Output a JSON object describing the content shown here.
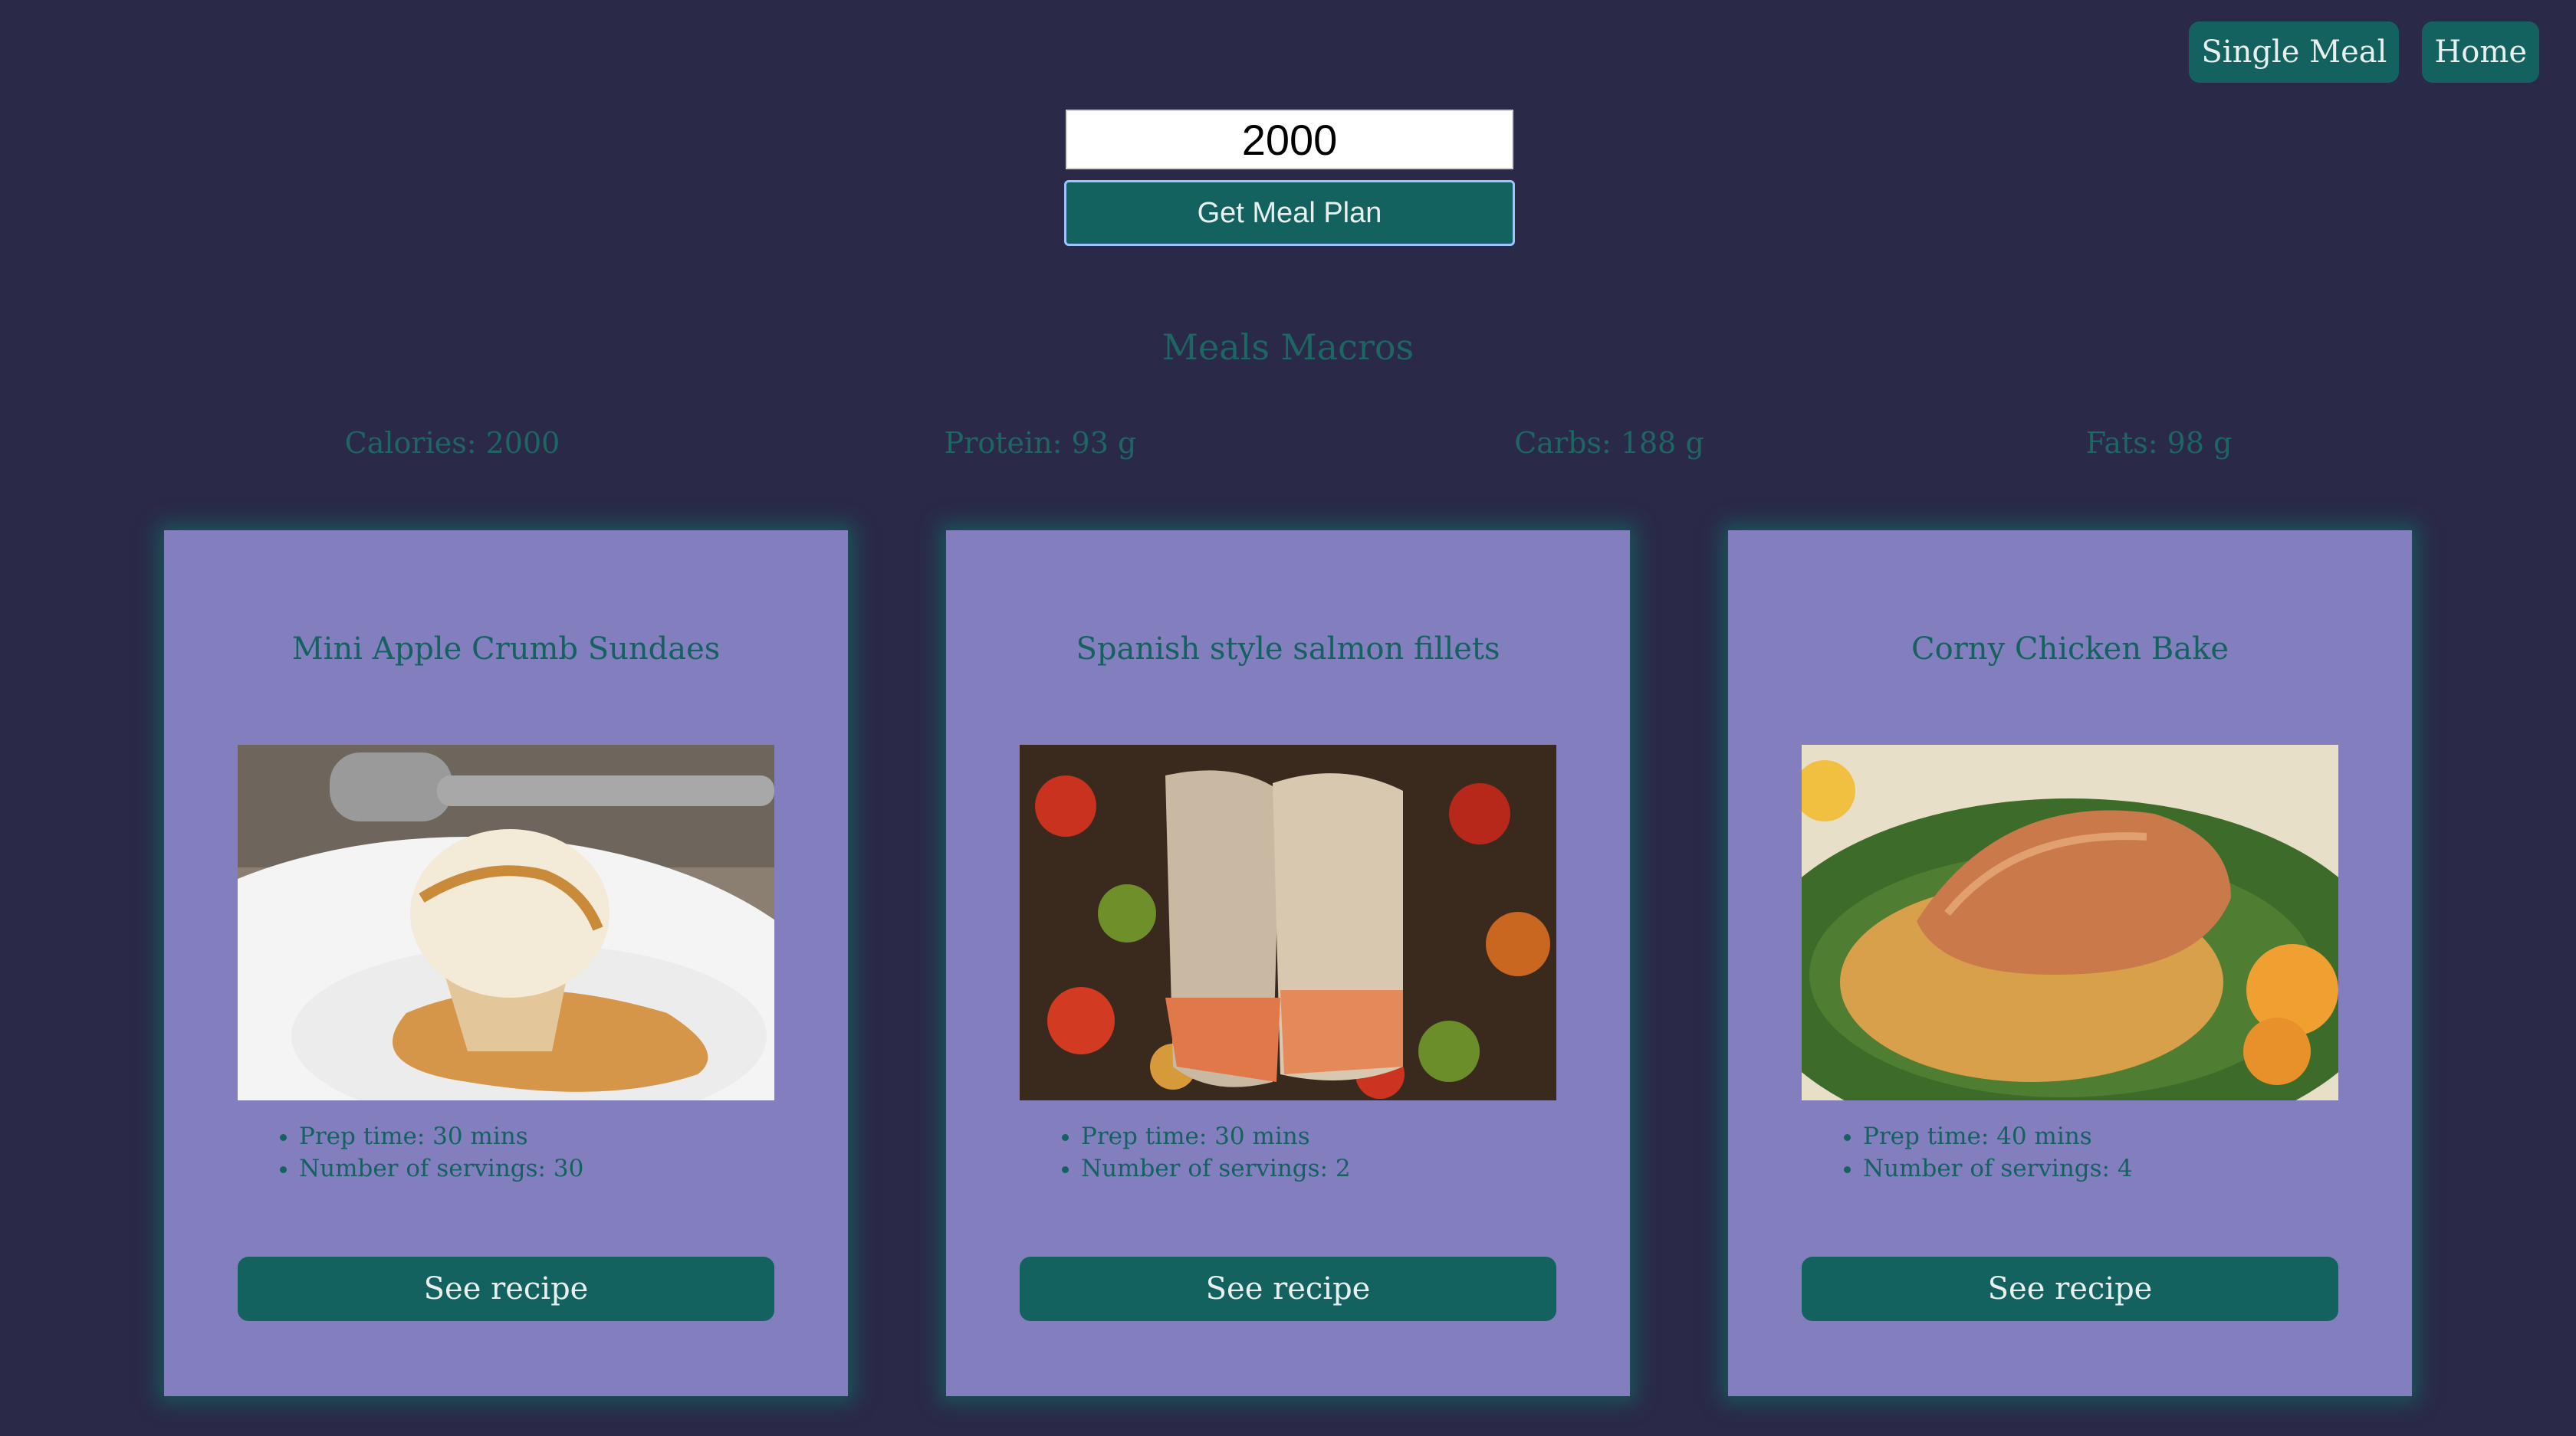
{
  "nav": {
    "single_meal": "Single Meal",
    "home": "Home"
  },
  "form": {
    "calories_value": "2000",
    "submit_label": "Get Meal Plan"
  },
  "macros": {
    "title": "Meals Macros",
    "calories": "Calories: 2000",
    "protein": "Protein: 93 g",
    "carbs": "Carbs: 188 g",
    "fats": "Fats: 98 g"
  },
  "meals": [
    {
      "title": "Mini Apple Crumb Sundaes",
      "prep": "Prep time: 30 mins",
      "servings": "Number of servings: 30",
      "button": "See recipe",
      "image": "ice-cream-sundae-photo"
    },
    {
      "title": "Spanish style salmon fillets",
      "prep": "Prep time: 30 mins",
      "servings": "Number of servings: 2",
      "button": "See recipe",
      "image": "salmon-vegetables-photo"
    },
    {
      "title": "Corny Chicken Bake",
      "prep": "Prep time: 40 mins",
      "servings": "Number of servings: 4",
      "button": "See recipe",
      "image": "chicken-stuffing-photo"
    }
  ],
  "colors": {
    "background": "#2a2a48",
    "card": "#837fbf",
    "accent": "#14625f"
  }
}
